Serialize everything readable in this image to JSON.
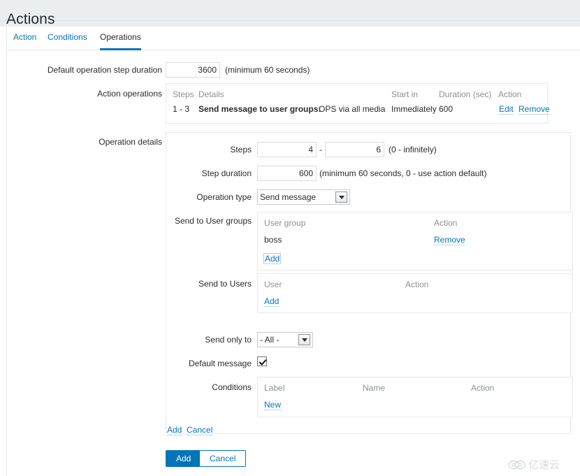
{
  "page": {
    "title": "Actions"
  },
  "tabs": [
    {
      "label": "Action",
      "active": false
    },
    {
      "label": "Conditions",
      "active": false
    },
    {
      "label": "Operations",
      "active": true
    }
  ],
  "form": {
    "default_step_duration": {
      "label": "Default operation step duration",
      "value": "3600",
      "hint": "(minimum 60 seconds)"
    },
    "action_operations": {
      "label": "Action operations",
      "columns": [
        "Steps",
        "Details",
        "Start in",
        "Duration (sec)",
        "Action"
      ],
      "rows": [
        {
          "steps": "1 - 3",
          "details_bold": "Send message to user groups:",
          "details_rest": "OPS via all media",
          "start_in": "Immediately",
          "duration": "600",
          "actions": [
            "Edit",
            "Remove"
          ]
        }
      ]
    },
    "operation_details": {
      "label": "Operation details",
      "steps": {
        "label": "Steps",
        "from": "4",
        "separator": "-",
        "to": "6",
        "hint": "(0 - infinitely)"
      },
      "step_duration": {
        "label": "Step duration",
        "value": "600",
        "hint": "(minimum 60 seconds, 0 - use action default)"
      },
      "operation_type": {
        "label": "Operation type",
        "value": "Send message",
        "options": [
          "Send message"
        ]
      },
      "send_to_user_groups": {
        "label": "Send to User groups",
        "columns": [
          "User group",
          "Action"
        ],
        "rows": [
          {
            "name": "boss",
            "action": "Remove"
          }
        ],
        "add_label": "Add"
      },
      "send_to_users": {
        "label": "Send to Users",
        "columns": [
          "User",
          "Action"
        ],
        "rows": [],
        "add_label": "Add"
      },
      "send_only_to": {
        "label": "Send only to",
        "value": "- All -",
        "options": [
          "- All -"
        ]
      },
      "default_message": {
        "label": "Default message",
        "checked": true
      },
      "conditions": {
        "label": "Conditions",
        "columns": [
          "Label",
          "Name",
          "Action"
        ],
        "rows": [],
        "new_label": "New"
      },
      "inline_actions": {
        "add_label": "Add",
        "cancel_label": "Cancel"
      }
    }
  },
  "footer": {
    "submit_label": "Add",
    "cancel_label": "Cancel"
  },
  "watermark": {
    "text": "亿速云",
    "icon": "cloud-icon"
  },
  "colors": {
    "accent": "#0275b8",
    "header_band": "#ebeef0",
    "muted_text": "#8b9196",
    "border": "#e6e9ea"
  }
}
